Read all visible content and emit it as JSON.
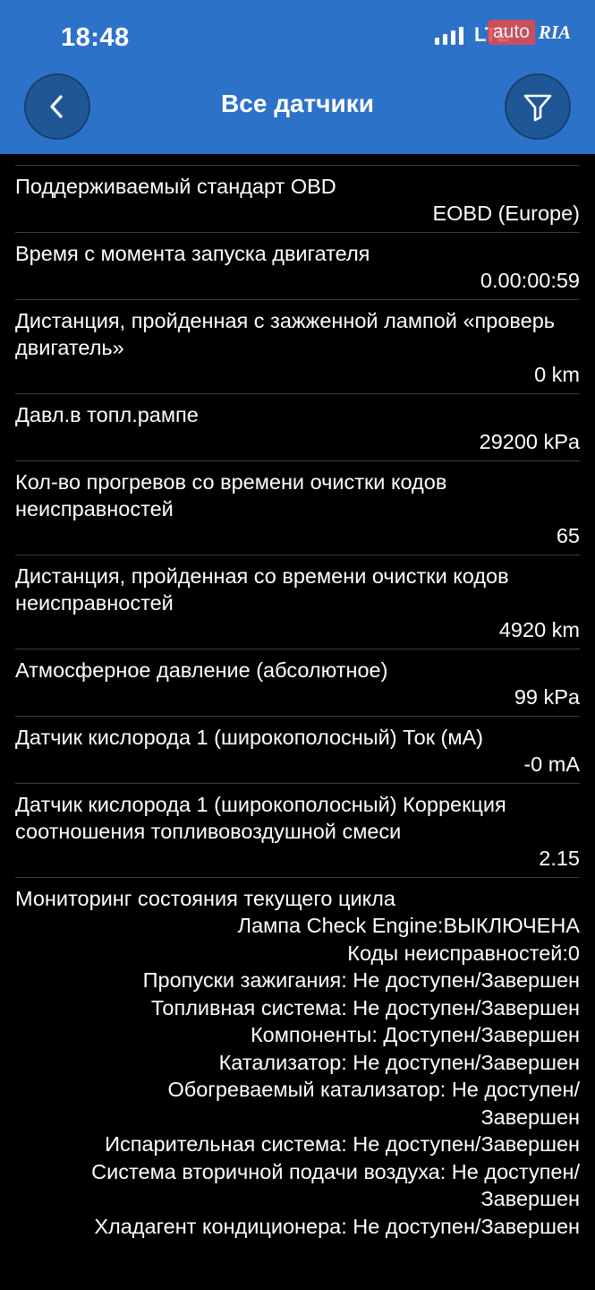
{
  "status_bar": {
    "time": "18:48",
    "network": "LTE"
  },
  "watermark": {
    "part1": "auto",
    "part2": "RIA"
  },
  "header": {
    "title": "Все датчики"
  },
  "icons": {
    "back": "chevron-left-icon",
    "filter": "filter-funnel-icon"
  },
  "colors": {
    "header_bg": "#2c72c8",
    "button_bg": "#1f5796",
    "background": "#000000",
    "divider": "#3d3d3d"
  },
  "sensors": [
    {
      "name": "Поддерживаемый стандарт OBD",
      "value": "EOBD (Europe)"
    },
    {
      "name": "Время с момента запуска двигателя",
      "value": "0.00:00:59"
    },
    {
      "name": "Дистанция, пройденная с зажженной лампой «проверь двигатель»",
      "value": "0 km"
    },
    {
      "name": "Давл.в топл.рампе",
      "value": "29200 kPa"
    },
    {
      "name": "Кол-во прогревов со времени очистки кодов неисправностей",
      "value": "65"
    },
    {
      "name": "Дистанция, пройденная со времени очистки кодов неисправностей",
      "value": "4920 km"
    },
    {
      "name": "Атмосферное давление (абсолютное)",
      "value": "99 kPa"
    },
    {
      "name": "Датчик кислорода 1 (широкополосный) Ток (мА)",
      "value": "-0 mA"
    },
    {
      "name": "Датчик кислорода 1 (широкополосный) Коррекция соотношения топливовоздушной смеси",
      "value": "2.15"
    }
  ],
  "monitor": {
    "title": "Мониторинг состояния текущего цикла",
    "lines": [
      "Лампа Check Engine:ВЫКЛЮЧЕНА",
      "Коды неисправностей:0",
      "Пропуски зажигания: Не доступен/Завершен",
      "Топливная система: Не доступен/Завершен",
      "Компоненты: Доступен/Завершен",
      "Катализатор: Не доступен/Завершен",
      "Обогреваемый катализатор: Не доступен/",
      "Завершен",
      "Испарительная система: Не доступен/Завершен",
      "Система вторичной подачи воздуха: Не доступен/",
      "Завершен",
      "Хладагент кондиционера: Не доступен/Завершен"
    ]
  }
}
